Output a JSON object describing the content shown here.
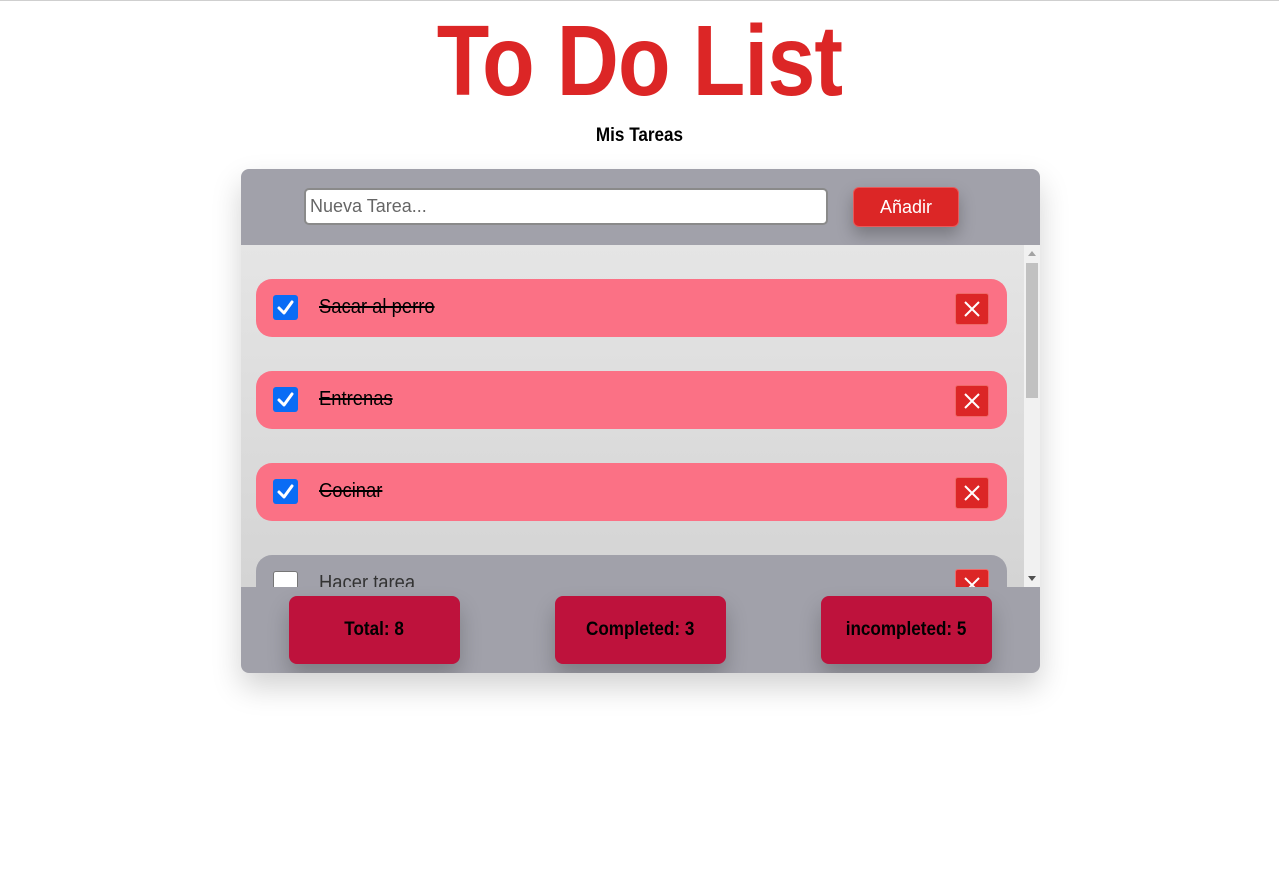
{
  "header": {
    "title": "To Do List",
    "subtitle": "Mis Tareas"
  },
  "new_task": {
    "placeholder": "Nueva Tarea...",
    "value": "",
    "add_label": "Añadir"
  },
  "tasks": [
    {
      "text": "Sacar al perro",
      "completed": true
    },
    {
      "text": "Entrenas",
      "completed": true
    },
    {
      "text": "Cocinar",
      "completed": true
    },
    {
      "text": "Hacer tarea",
      "completed": false
    }
  ],
  "stats": {
    "total": "Total: 8",
    "completed": "Completed: 3",
    "incompleted": "incompleted: 5"
  },
  "colors": {
    "title": "#dc2626",
    "panel": "#a1a1aa",
    "task_done": "#fb7185",
    "stat_card": "#be123c",
    "checkbox": "#0a6cf5"
  }
}
